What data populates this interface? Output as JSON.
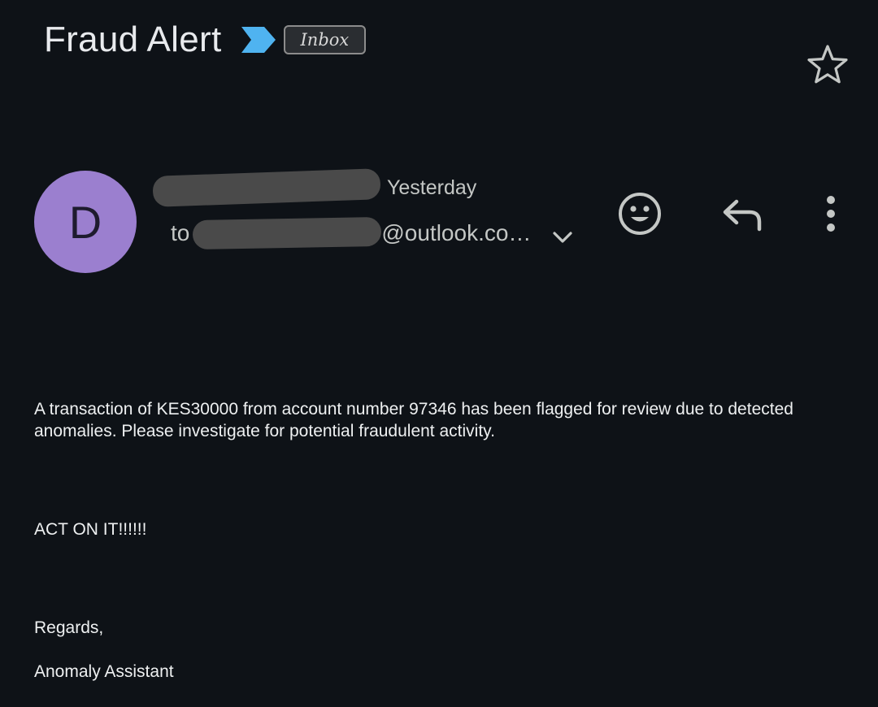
{
  "email": {
    "subject": "Fraud Alert",
    "label_chip": "Inbox",
    "timestamp": "Yesterday",
    "to_label": "to",
    "recipient_visible_suffix": "@outlook.co…",
    "avatar_letter": "D",
    "body_paragraph_1": "A transaction of KES30000 from account number 97346 has been flagged for review due to detected anomalies. Please investigate for potential fraudulent activity.",
    "body_paragraph_2": "ACT ON IT!!!!!!",
    "closing": "Regards,",
    "signature": "Anomaly Assistant"
  },
  "icons": {
    "importance": "importance-marker-icon",
    "star": "star-outline-icon",
    "expand": "chevron-down-icon",
    "emoji": "smiley-face-icon",
    "reply": "reply-arrow-icon",
    "more": "more-vertical-icon"
  },
  "colors": {
    "background": "#0e1217",
    "avatar": "#9b7fcf",
    "importance_marker": "#4fb3f0",
    "text_primary": "#e8eaed",
    "text_secondary": "#c4c7c5",
    "redaction": "#4a4a4a"
  }
}
